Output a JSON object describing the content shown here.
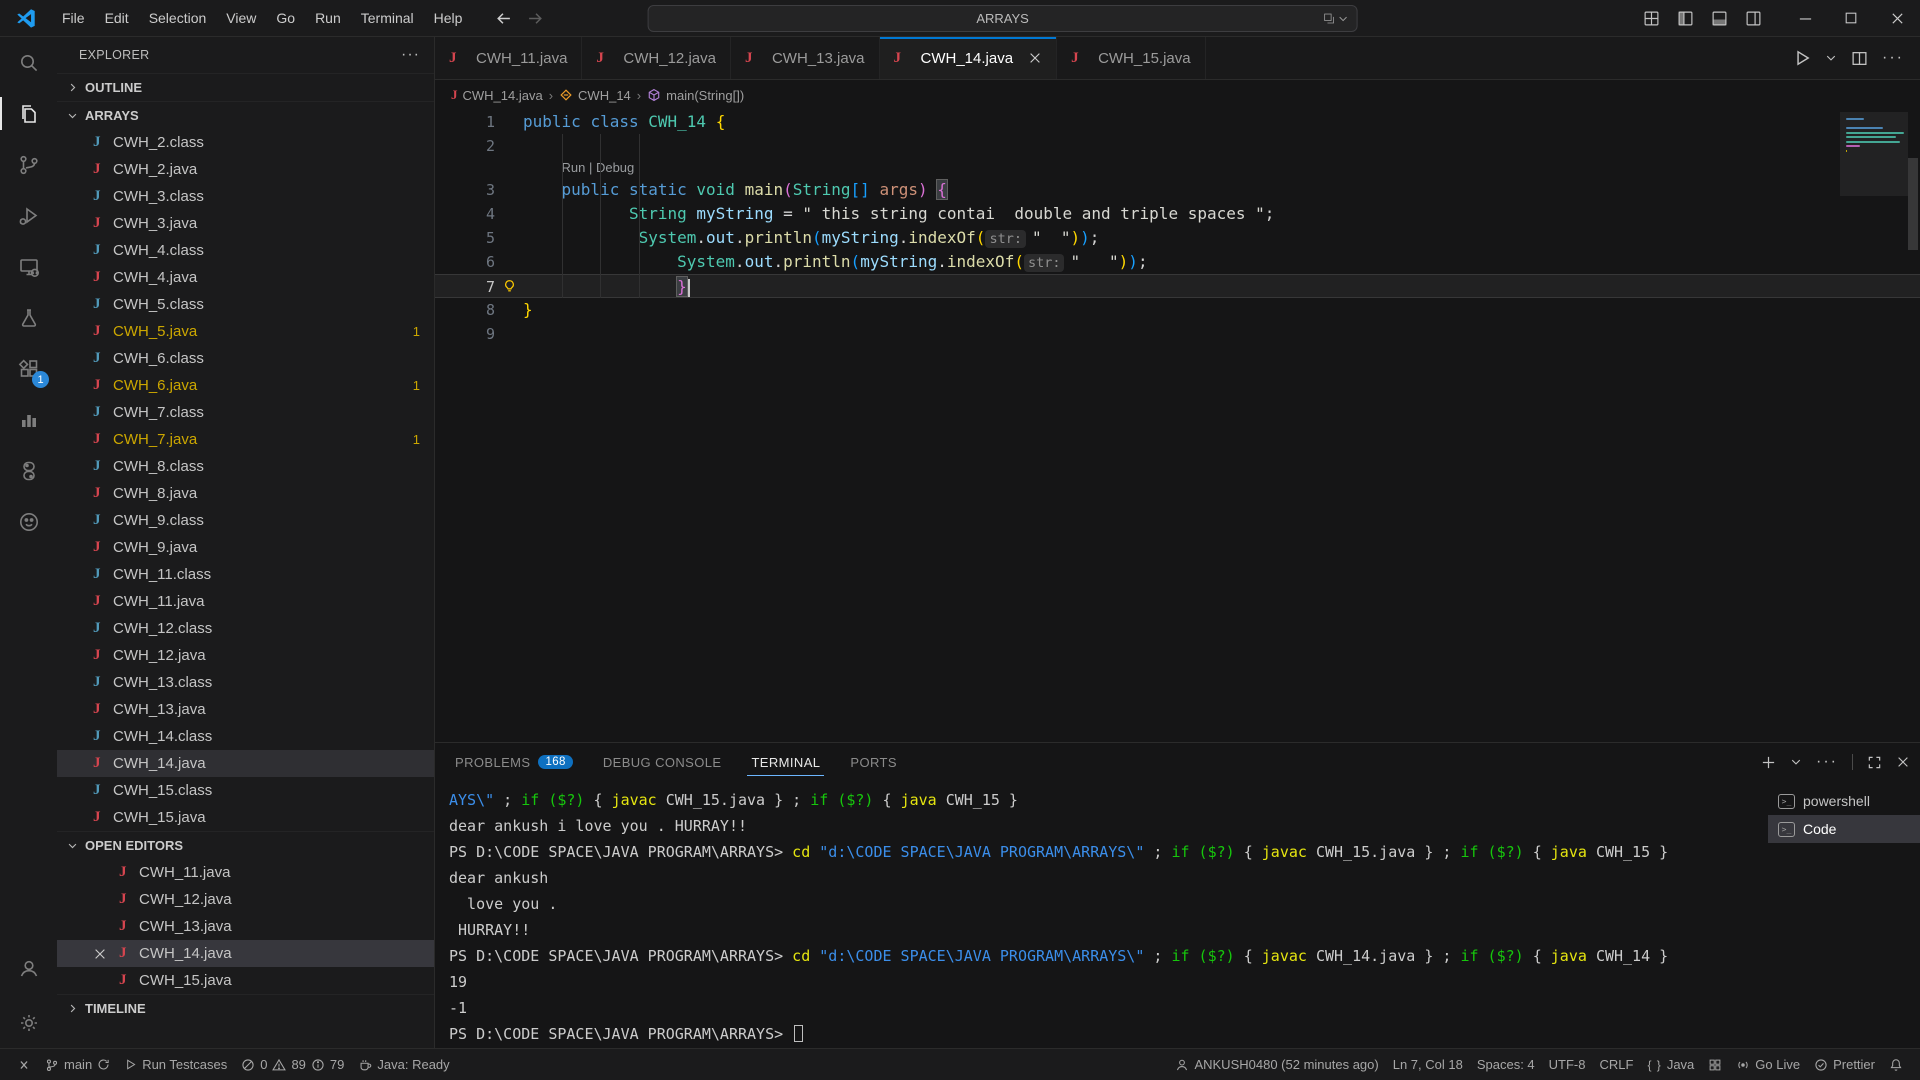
{
  "titlebar": {
    "menus": [
      "File",
      "Edit",
      "Selection",
      "View",
      "Go",
      "Run",
      "Terminal",
      "Help"
    ],
    "search": {
      "value": "ARRAYS"
    },
    "nav_icons": [
      "arrow-left",
      "arrow-right"
    ],
    "layout_icons": [
      "layout-grid",
      "layout-sidebar-left",
      "layout-panel",
      "layout-sidebar-right"
    ],
    "window_icons": [
      "minimize",
      "maximize",
      "close"
    ]
  },
  "activitybar": {
    "top": [
      {
        "name": "search",
        "icon": "search"
      },
      {
        "name": "explorer",
        "icon": "files",
        "active": true
      },
      {
        "name": "source-control",
        "icon": "source-control"
      },
      {
        "name": "run-debug",
        "icon": "debug"
      },
      {
        "name": "remote-explorer",
        "icon": "remote"
      },
      {
        "name": "testing",
        "icon": "beaker"
      },
      {
        "name": "extensions",
        "icon": "extensions",
        "badge": "1"
      },
      {
        "name": "chart-extension",
        "icon": "chart"
      },
      {
        "name": "python-extension",
        "icon": "python"
      },
      {
        "name": "misc-extension",
        "icon": "misc"
      }
    ],
    "bottom": [
      {
        "name": "accounts",
        "icon": "account"
      },
      {
        "name": "settings",
        "icon": "gear"
      }
    ]
  },
  "sidebar": {
    "title": "EXPLORER",
    "sections": {
      "outline": "OUTLINE",
      "folder": "ARRAYS",
      "open_editors": "OPEN EDITORS",
      "timeline": "TIMELINE"
    },
    "files": [
      {
        "name": "CWH_2.class",
        "kind": "class"
      },
      {
        "name": "CWH_2.java",
        "kind": "java"
      },
      {
        "name": "CWH_3.class",
        "kind": "class"
      },
      {
        "name": "CWH_3.java",
        "kind": "java"
      },
      {
        "name": "CWH_4.class",
        "kind": "class"
      },
      {
        "name": "CWH_4.java",
        "kind": "java"
      },
      {
        "name": "CWH_5.class",
        "kind": "class"
      },
      {
        "name": "CWH_5.java",
        "kind": "java",
        "warn": true,
        "badge": "1"
      },
      {
        "name": "CWH_6.class",
        "kind": "class"
      },
      {
        "name": "CWH_6.java",
        "kind": "java",
        "warn": true,
        "badge": "1"
      },
      {
        "name": "CWH_7.class",
        "kind": "class"
      },
      {
        "name": "CWH_7.java",
        "kind": "java",
        "warn": true,
        "badge": "1"
      },
      {
        "name": "CWH_8.class",
        "kind": "class"
      },
      {
        "name": "CWH_8.java",
        "kind": "java"
      },
      {
        "name": "CWH_9.class",
        "kind": "class"
      },
      {
        "name": "CWH_9.java",
        "kind": "java"
      },
      {
        "name": "CWH_11.class",
        "kind": "class"
      },
      {
        "name": "CWH_11.java",
        "kind": "java"
      },
      {
        "name": "CWH_12.class",
        "kind": "class"
      },
      {
        "name": "CWH_12.java",
        "kind": "java"
      },
      {
        "name": "CWH_13.class",
        "kind": "class"
      },
      {
        "name": "CWH_13.java",
        "kind": "java"
      },
      {
        "name": "CWH_14.class",
        "kind": "class"
      },
      {
        "name": "CWH_14.java",
        "kind": "java",
        "selected": true
      },
      {
        "name": "CWH_15.class",
        "kind": "class"
      },
      {
        "name": "CWH_15.java",
        "kind": "java"
      }
    ],
    "open_editors": [
      {
        "name": "CWH_11.java"
      },
      {
        "name": "CWH_12.java"
      },
      {
        "name": "CWH_13.java"
      },
      {
        "name": "CWH_14.java",
        "active": true
      },
      {
        "name": "CWH_15.java"
      }
    ]
  },
  "tabs": [
    {
      "label": "CWH_11.java"
    },
    {
      "label": "CWH_12.java"
    },
    {
      "label": "CWH_13.java"
    },
    {
      "label": "CWH_14.java",
      "active": true
    },
    {
      "label": "CWH_15.java"
    }
  ],
  "editor_actions": [
    "run",
    "chevron-down",
    "split-editor",
    "ellipsis"
  ],
  "breadcrumb": [
    {
      "label": "CWH_14.java",
      "icon": "java-j"
    },
    {
      "label": "CWH_14",
      "icon": "symbol-class"
    },
    {
      "label": "main(String[])",
      "icon": "symbol-method"
    }
  ],
  "editor": {
    "codelens": "Run | Debug",
    "lines": [
      {
        "num": 1,
        "tokens": [
          {
            "t": "public",
            "c": "kw"
          },
          {
            "t": " ",
            "c": "ws"
          },
          {
            "t": "class",
            "c": "kw"
          },
          {
            "t": " ",
            "c": "ws"
          },
          {
            "t": "CWH_14",
            "c": "type"
          },
          {
            "t": " ",
            "c": "ws"
          },
          {
            "t": "{",
            "c": "b1"
          }
        ]
      },
      {
        "num": 2,
        "tokens": []
      },
      {
        "num": 3,
        "codelens": true,
        "tokens": [
          {
            "t": "    ",
            "c": "ws"
          },
          {
            "t": "public",
            "c": "kw"
          },
          {
            "t": " ",
            "c": "ws"
          },
          {
            "t": "static",
            "c": "kw"
          },
          {
            "t": " ",
            "c": "ws"
          },
          {
            "t": "void",
            "c": "type"
          },
          {
            "t": " ",
            "c": "ws"
          },
          {
            "t": "main",
            "c": "fn"
          },
          {
            "t": "(",
            "c": "b2"
          },
          {
            "t": "String",
            "c": "type"
          },
          {
            "t": "[]",
            "c": "b3"
          },
          {
            "t": " ",
            "c": "ws"
          },
          {
            "t": "args",
            "c": "param"
          },
          {
            "t": ")",
            "c": "b2"
          },
          {
            "t": " ",
            "c": "ws"
          },
          {
            "t": "{",
            "c": "b2 match"
          }
        ]
      },
      {
        "num": 4,
        "tokens": [
          {
            "t": "           ",
            "c": "ws"
          },
          {
            "t": "String",
            "c": "type"
          },
          {
            "t": " ",
            "c": "ws"
          },
          {
            "t": "myString",
            "c": "var"
          },
          {
            "t": " ",
            "c": "ws"
          },
          {
            "t": "=",
            "c": "pun"
          },
          {
            "t": " ",
            "c": "ws"
          },
          {
            "t": "\" this string contai  double and triple spaces \"",
            "c": "str"
          },
          {
            "t": ";",
            "c": "pun"
          }
        ]
      },
      {
        "num": 5,
        "tokens": [
          {
            "t": "            ",
            "c": "ws"
          },
          {
            "t": "System",
            "c": "type"
          },
          {
            "t": ".",
            "c": "pun"
          },
          {
            "t": "out",
            "c": "var"
          },
          {
            "t": ".",
            "c": "pun"
          },
          {
            "t": "println",
            "c": "fn"
          },
          {
            "t": "(",
            "c": "b3"
          },
          {
            "t": "myString",
            "c": "var"
          },
          {
            "t": ".",
            "c": "pun"
          },
          {
            "t": "indexOf",
            "c": "fn"
          },
          {
            "t": "(",
            "c": "b1"
          },
          {
            "t": "str:",
            "c": "inlay"
          },
          {
            "t": "\"  \"",
            "c": "str"
          },
          {
            "t": ")",
            "c": "b1"
          },
          {
            "t": ")",
            "c": "b3"
          },
          {
            "t": ";",
            "c": "pun"
          }
        ]
      },
      {
        "num": 6,
        "tokens": [
          {
            "t": "                ",
            "c": "ws"
          },
          {
            "t": "System",
            "c": "type"
          },
          {
            "t": ".",
            "c": "pun"
          },
          {
            "t": "out",
            "c": "var"
          },
          {
            "t": ".",
            "c": "pun"
          },
          {
            "t": "println",
            "c": "fn"
          },
          {
            "t": "(",
            "c": "b3"
          },
          {
            "t": "myString",
            "c": "var"
          },
          {
            "t": ".",
            "c": "pun"
          },
          {
            "t": "indexOf",
            "c": "fn"
          },
          {
            "t": "(",
            "c": "b1"
          },
          {
            "t": "str:",
            "c": "inlay"
          },
          {
            "t": "\"   \"",
            "c": "str"
          },
          {
            "t": ")",
            "c": "b1"
          },
          {
            "t": ")",
            "c": "b3"
          },
          {
            "t": ";",
            "c": "pun"
          }
        ]
      },
      {
        "num": 7,
        "current": true,
        "lightbulb": true,
        "caret": true,
        "tokens": [
          {
            "t": "                ",
            "c": "ws"
          },
          {
            "t": "}",
            "c": "b2 match"
          }
        ]
      },
      {
        "num": 8,
        "tokens": [
          {
            "t": "}",
            "c": "b1"
          }
        ]
      },
      {
        "num": 9,
        "tokens": []
      }
    ]
  },
  "panel": {
    "tabs": [
      {
        "label": "PROBLEMS",
        "badge": "168"
      },
      {
        "label": "DEBUG CONSOLE"
      },
      {
        "label": "TERMINAL",
        "active": true
      },
      {
        "label": "PORTS"
      }
    ],
    "action_icons": [
      "add",
      "chevron-down",
      "ellipsis",
      "maximize-panel",
      "close"
    ],
    "terminal": {
      "lines": [
        {
          "tokens": [
            {
              "t": "AYS\\\"",
              "c": "c"
            },
            {
              "t": " ; ",
              "c": "w"
            },
            {
              "t": "if ($?)",
              "c": "g"
            },
            {
              "t": " { ",
              "c": "w"
            },
            {
              "t": "javac ",
              "c": "y"
            },
            {
              "t": "CWH_15.java } ; ",
              "c": "w"
            },
            {
              "t": "if ($?)",
              "c": "g"
            },
            {
              "t": " { ",
              "c": "w"
            },
            {
              "t": "java ",
              "c": "y"
            },
            {
              "t": "CWH_15 }",
              "c": "w"
            }
          ]
        },
        {
          "tokens": [
            {
              "t": "dear ankush i love you . HURRAY!!",
              "c": "w"
            }
          ]
        },
        {
          "tokens": [
            {
              "t": "PS D:\\CODE SPACE\\JAVA PROGRAM\\ARRAYS> ",
              "c": "w"
            },
            {
              "t": "cd ",
              "c": "y"
            },
            {
              "t": "\"d:\\CODE SPACE\\JAVA PROGRAM\\ARRAYS\\\"",
              "c": "c"
            },
            {
              "t": " ; ",
              "c": "w"
            },
            {
              "t": "if ($?)",
              "c": "g"
            },
            {
              "t": " { ",
              "c": "w"
            },
            {
              "t": "javac ",
              "c": "y"
            },
            {
              "t": "CWH_15.java } ; ",
              "c": "w"
            },
            {
              "t": "if ($?)",
              "c": "g"
            },
            {
              "t": " { ",
              "c": "w"
            },
            {
              "t": "java ",
              "c": "y"
            },
            {
              "t": "CWH_15 }",
              "c": "w"
            }
          ]
        },
        {
          "tokens": [
            {
              "t": "dear ankush",
              "c": "w"
            }
          ]
        },
        {
          "tokens": [
            {
              "t": "  love you .",
              "c": "w"
            }
          ]
        },
        {
          "tokens": [
            {
              "t": " HURRAY!!",
              "c": "w"
            }
          ]
        },
        {
          "tokens": [
            {
              "t": "PS D:\\CODE SPACE\\JAVA PROGRAM\\ARRAYS> ",
              "c": "w"
            },
            {
              "t": "cd ",
              "c": "y"
            },
            {
              "t": "\"d:\\CODE SPACE\\JAVA PROGRAM\\ARRAYS\\\"",
              "c": "c"
            },
            {
              "t": " ; ",
              "c": "w"
            },
            {
              "t": "if ($?)",
              "c": "g"
            },
            {
              "t": " { ",
              "c": "w"
            },
            {
              "t": "javac ",
              "c": "y"
            },
            {
              "t": "CWH_14.java } ; ",
              "c": "w"
            },
            {
              "t": "if ($?)",
              "c": "g"
            },
            {
              "t": " { ",
              "c": "w"
            },
            {
              "t": "java ",
              "c": "y"
            },
            {
              "t": "CWH_14 }",
              "c": "w"
            }
          ]
        },
        {
          "tokens": [
            {
              "t": "19",
              "c": "w"
            }
          ]
        },
        {
          "tokens": [
            {
              "t": "-1",
              "c": "w"
            }
          ]
        },
        {
          "tokens": [
            {
              "t": "PS D:\\CODE SPACE\\JAVA PROGRAM\\ARRAYS> ",
              "c": "w"
            }
          ],
          "cursor": true
        }
      ],
      "list": [
        {
          "label": "powershell"
        },
        {
          "label": "Code",
          "active": true
        }
      ]
    }
  },
  "statusbar": {
    "left": [
      {
        "name": "remote",
        "icon": "remote-sb",
        "label": ""
      },
      {
        "name": "branch",
        "icon": "branch",
        "label": "main",
        "icon2": "sync"
      },
      {
        "name": "run-testcases",
        "icon": "play",
        "label": "Run Testcases"
      },
      {
        "name": "problems-summary",
        "parts": [
          {
            "icon": "error",
            "text": "0"
          },
          {
            "icon": "warning",
            "text": "89"
          },
          {
            "icon": "info",
            "text": "79"
          }
        ]
      },
      {
        "name": "java-status",
        "icon": "coffee",
        "label": "Java: Ready"
      }
    ],
    "right": [
      {
        "name": "scm-author",
        "icon": "person",
        "label": "ANKUSH0480 (52 minutes ago)"
      },
      {
        "name": "cursor-position",
        "label": "Ln 7, Col 18"
      },
      {
        "name": "indentation",
        "label": "Spaces: 4"
      },
      {
        "name": "encoding",
        "label": "UTF-8"
      },
      {
        "name": "eol",
        "label": "CRLF"
      },
      {
        "name": "language-mode",
        "icon": "braces",
        "label": "Java"
      },
      {
        "name": "table-status",
        "icon": "grid",
        "label": ""
      },
      {
        "name": "go-live",
        "icon": "broadcast",
        "label": "Go Live"
      },
      {
        "name": "prettier",
        "icon": "check-circle",
        "label": "Prettier"
      },
      {
        "name": "notifications",
        "icon": "bell",
        "label": ""
      }
    ]
  },
  "colors": {
    "accent": "#0078d4",
    "badge_blue": "#2b88d8",
    "warn_file": "#cca700",
    "java_icon_red": "#d6454f",
    "class_icon_blue": "#519aba",
    "terminal_yellow": "#e5e510",
    "terminal_green": "#16c60c",
    "terminal_blue": "#3b8eea"
  }
}
